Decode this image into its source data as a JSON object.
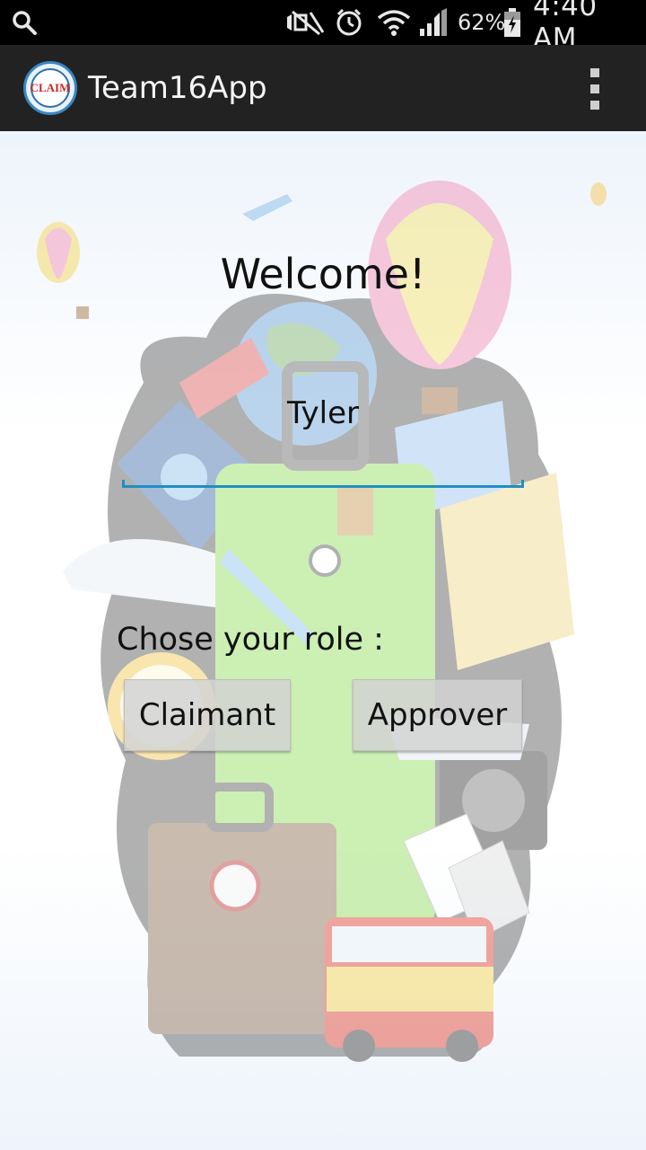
{
  "status_bar": {
    "battery_percent": "62%",
    "time": "4:40 AM",
    "icons": [
      "search-icon",
      "mute-icon",
      "alarm-icon",
      "wifi-icon",
      "signal-icon",
      "battery-icon"
    ]
  },
  "action_bar": {
    "logo_text": "CLAIM",
    "title": "Team16App",
    "overflow_icon": "overflow-menu-icon"
  },
  "main": {
    "welcome": "Welcome!",
    "name_value": "Tyler",
    "role_label": "Chose your role :",
    "buttons": {
      "claimant": "Claimant",
      "approver": "Approver"
    }
  },
  "colors": {
    "status_bar_bg": "#000000",
    "action_bar_bg": "#222222",
    "input_underline": "#1f8fc4",
    "button_bg": "#d2d2d2"
  }
}
